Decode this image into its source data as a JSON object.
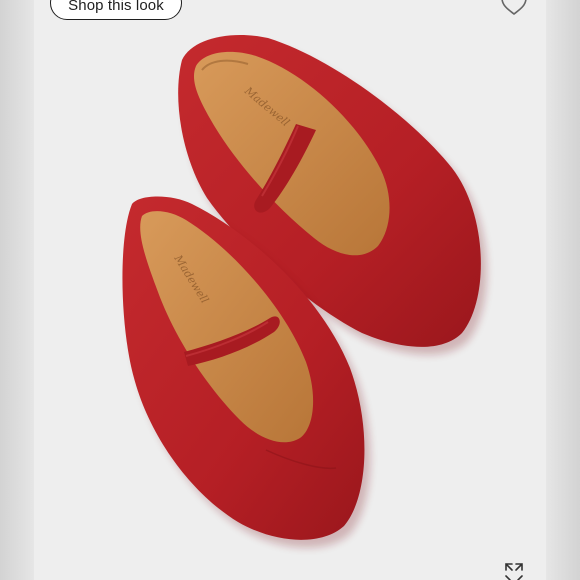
{
  "shop_button": {
    "label": "Shop this look"
  },
  "icons": {
    "favorite": "heart-icon",
    "expand": "expand-icon"
  },
  "product_image": {
    "subject": "red suede mary jane flats",
    "insole_brand": "Madewell"
  },
  "colors": {
    "suede_red": "#b51f25",
    "suede_shadow": "#8e1419",
    "insole_tan": "#c98a4b",
    "background": "#eeeeee"
  }
}
